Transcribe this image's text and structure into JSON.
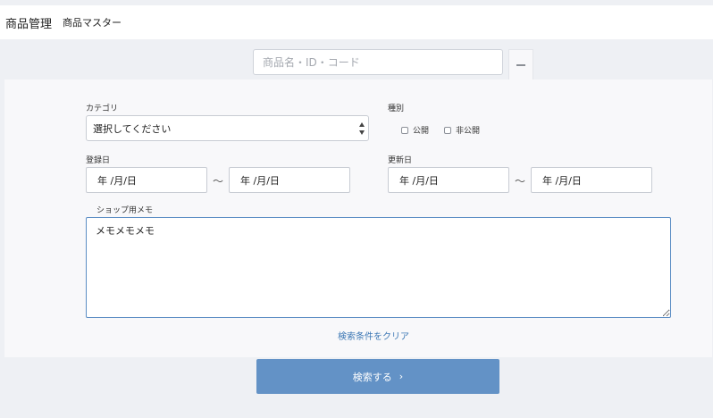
{
  "header": {
    "title": "商品管理",
    "subtitle": "商品マスター"
  },
  "search": {
    "placeholder": "商品名・ID・コード",
    "value": ""
  },
  "toggle": {
    "icon": "minus-icon"
  },
  "form": {
    "category": {
      "label": "カテゴリ",
      "selected": "選択してください"
    },
    "type": {
      "label": "種別",
      "options": [
        "公開",
        "非公開"
      ]
    },
    "registered": {
      "label": "登録日",
      "from": "年 /月/日",
      "to": "年 /月/日",
      "separator": "〜"
    },
    "updated": {
      "label": "更新日",
      "from": "年 /月/日",
      "to": "年 /月/日",
      "separator": "〜"
    },
    "memo": {
      "label": "ショップ用メモ",
      "value": "メモメモメモ"
    },
    "clear_label": "検索条件をクリア",
    "submit_label": "検索する"
  },
  "colors": {
    "accent": "#6392c6",
    "link": "#3d78b5",
    "focus_border": "#5b8dc4"
  }
}
